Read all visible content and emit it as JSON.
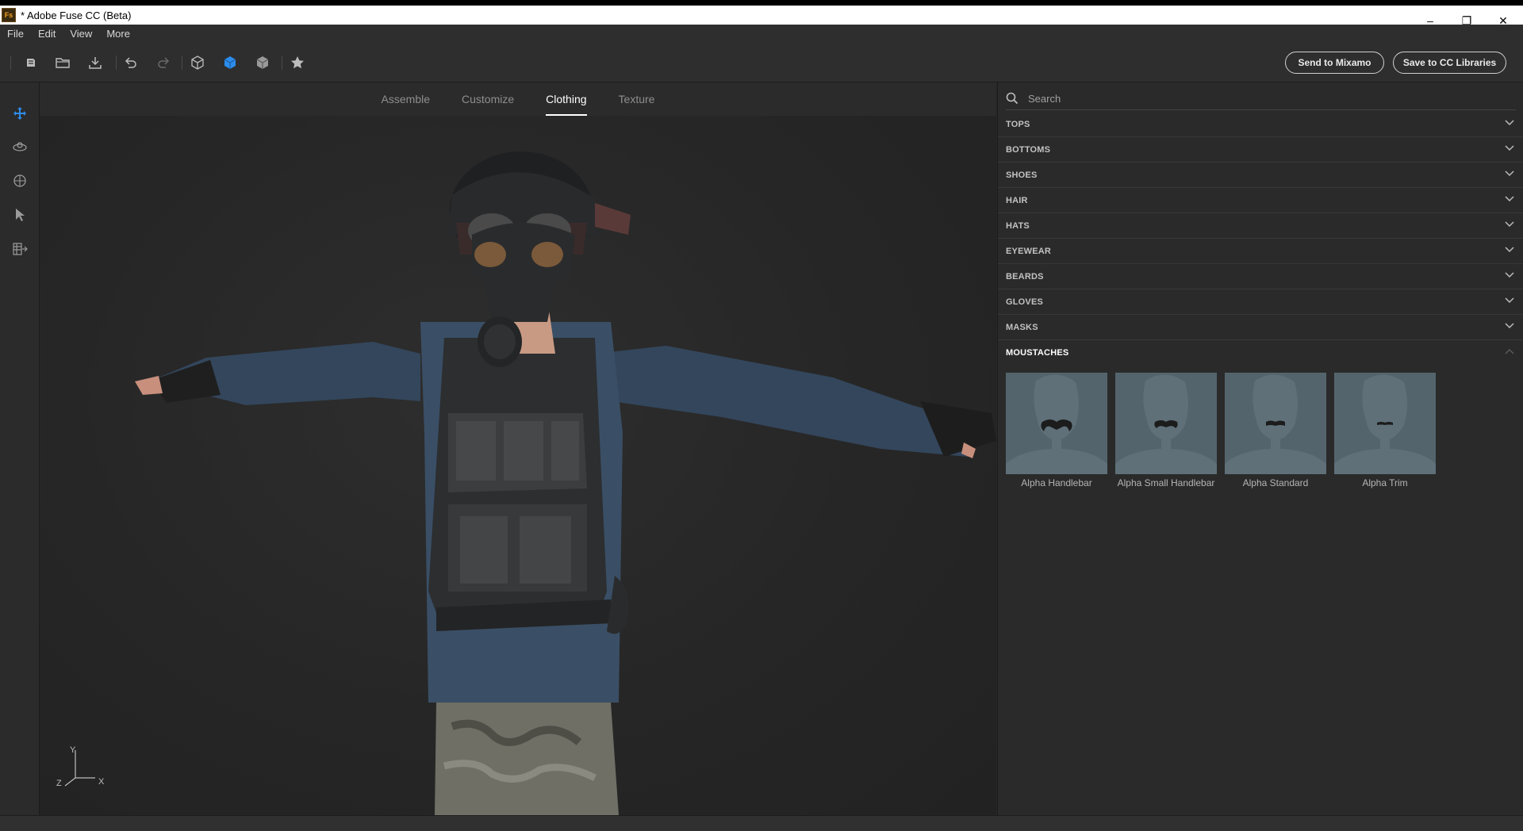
{
  "window": {
    "title": "* Adobe Fuse CC (Beta)",
    "logo": "Fs",
    "controls": {
      "minimize": "–",
      "restore": "❐",
      "close": "✕"
    }
  },
  "menu": [
    "File",
    "Edit",
    "View",
    "More"
  ],
  "toolbar": {
    "icons": [
      "new-file-icon",
      "open-folder-icon",
      "import-icon",
      "undo-icon",
      "redo-icon",
      "cube-wireframe-icon",
      "cube-solid-icon",
      "cube-shaded-icon",
      "star-icon"
    ],
    "send_label": "Send to Mixamo",
    "save_label": "Save to CC Libraries",
    "accent": "#2d8ceb"
  },
  "left_rail": [
    "move-tool-icon",
    "orbit-icon",
    "target-icon",
    "select-arrow-icon",
    "grid-snap-icon"
  ],
  "tabs": [
    {
      "label": "Assemble",
      "active": false
    },
    {
      "label": "Customize",
      "active": false
    },
    {
      "label": "Clothing",
      "active": true
    },
    {
      "label": "Texture",
      "active": false
    }
  ],
  "viewport": {
    "axis_y": "Y",
    "axis_x": "X",
    "axis_z": "Z"
  },
  "search": {
    "placeholder": "Search"
  },
  "categories": [
    {
      "label": "TOPS",
      "expanded": false
    },
    {
      "label": "BOTTOMS",
      "expanded": false
    },
    {
      "label": "SHOES",
      "expanded": false
    },
    {
      "label": "HAIR",
      "expanded": false
    },
    {
      "label": "HATS",
      "expanded": false
    },
    {
      "label": "EYEWEAR",
      "expanded": false
    },
    {
      "label": "BEARDS",
      "expanded": false
    },
    {
      "label": "GLOVES",
      "expanded": false
    },
    {
      "label": "MASKS",
      "expanded": false
    },
    {
      "label": "MOUSTACHES",
      "expanded": true
    }
  ],
  "moustaches": [
    "Alpha Handlebar",
    "Alpha Small Handlebar",
    "Alpha Standard",
    "Alpha Trim"
  ]
}
